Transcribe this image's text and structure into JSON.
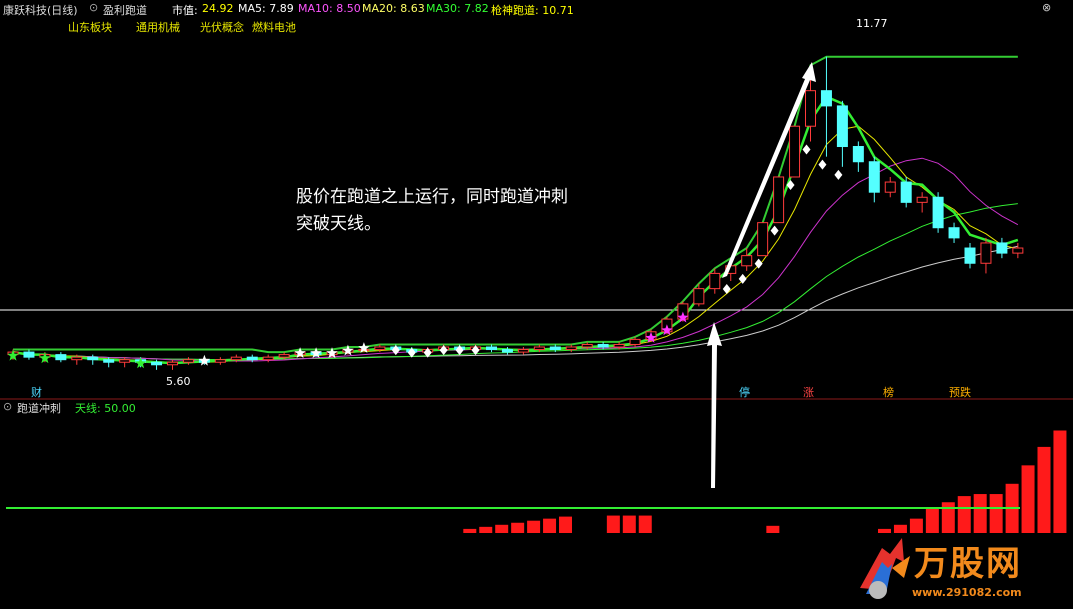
{
  "header": {
    "stock_name": "康跃科技(日线)",
    "indicator_name": "盈利跑道",
    "market_value_label": "市值:",
    "market_value": "24.92",
    "ma5": "MA5: 7.89",
    "ma10": "MA10: 8.50",
    "ma20": "MA20: 8.63",
    "ma30": "MA30: 7.82",
    "qsd": "枪神跑道: 10.71"
  },
  "tags": [
    "山东板块",
    "通用机械",
    "光伏概念",
    "燃料电池"
  ],
  "sub_indicator": {
    "name": "跑道冲刺",
    "tianxian": "天线: 50.00"
  },
  "annotation": {
    "line1": "股价在跑道之上运行，同时跑道冲刺",
    "line2": "突破天线。"
  },
  "price_labels": {
    "high": "11.77",
    "low": "5.60"
  },
  "event_markers": [
    {
      "text": "财",
      "color": "#4dd9ff"
    },
    {
      "text": "停",
      "color": "#4dd9ff"
    },
    {
      "text": "涨",
      "color": "#ff4444"
    },
    {
      "text": "榜",
      "color": "#ffb000"
    },
    {
      "text": "预跌",
      "color": "#ffb000"
    }
  ],
  "watermark": {
    "brand": "万股网",
    "url": "www.291082.com"
  },
  "colors": {
    "up": "#ff3b3b",
    "down": "#54ffff",
    "green_line": "#33ee33",
    "magenta_line": "#cc33cc",
    "yellow_line": "#e6e600",
    "white_line": "#cccccc",
    "track": "#33cc33",
    "header_yellow": "#ffff00",
    "ma10": "#ff55ff",
    "ma20": "#ffff66",
    "ma30": "#33ff33"
  },
  "chart_data": {
    "type": "candlestick",
    "candles": [
      [
        5.9,
        5.95,
        5.8,
        6.0
      ],
      [
        5.95,
        5.85,
        5.8,
        6.0
      ],
      [
        5.85,
        5.9,
        5.75,
        5.95
      ],
      [
        5.9,
        5.8,
        5.75,
        5.95
      ],
      [
        5.8,
        5.85,
        5.7,
        5.9
      ],
      [
        5.85,
        5.8,
        5.7,
        5.9
      ],
      [
        5.8,
        5.75,
        5.65,
        5.85
      ],
      [
        5.75,
        5.8,
        5.65,
        5.85
      ],
      [
        5.8,
        5.75,
        5.65,
        5.85
      ],
      [
        5.75,
        5.7,
        5.6,
        5.8
      ],
      [
        5.7,
        5.75,
        5.6,
        5.8
      ],
      [
        5.75,
        5.8,
        5.7,
        5.85
      ],
      [
        5.8,
        5.75,
        5.7,
        5.85
      ],
      [
        5.75,
        5.8,
        5.7,
        5.85
      ],
      [
        5.8,
        5.85,
        5.75,
        5.9
      ],
      [
        5.85,
        5.8,
        5.75,
        5.9
      ],
      [
        5.8,
        5.85,
        5.75,
        5.9
      ],
      [
        5.85,
        5.9,
        5.8,
        5.95
      ],
      [
        5.9,
        5.95,
        5.85,
        6.0
      ],
      [
        5.95,
        5.9,
        5.85,
        6.0
      ],
      [
        5.9,
        5.95,
        5.85,
        6.0
      ],
      [
        5.95,
        6.0,
        5.9,
        6.05
      ],
      [
        6.0,
        6.0,
        5.95,
        6.05
      ],
      [
        6.0,
        6.05,
        5.95,
        6.1
      ],
      [
        6.05,
        6.0,
        5.95,
        6.1
      ],
      [
        6.0,
        5.95,
        5.9,
        6.05
      ],
      [
        5.95,
        6.0,
        5.9,
        6.05
      ],
      [
        6.0,
        6.05,
        5.95,
        6.1
      ],
      [
        6.05,
        6.0,
        5.95,
        6.1
      ],
      [
        6.0,
        6.05,
        5.95,
        6.1
      ],
      [
        6.05,
        6.0,
        5.95,
        6.1
      ],
      [
        6.0,
        5.95,
        5.9,
        6.05
      ],
      [
        5.95,
        6.0,
        5.9,
        6.05
      ],
      [
        6.0,
        6.05,
        5.95,
        6.1
      ],
      [
        6.05,
        6.0,
        5.95,
        6.1
      ],
      [
        6.0,
        6.05,
        5.95,
        6.1
      ],
      [
        6.05,
        6.1,
        6.0,
        6.15
      ],
      [
        6.1,
        6.05,
        6.0,
        6.15
      ],
      [
        6.05,
        6.1,
        6.0,
        6.15
      ],
      [
        6.1,
        6.2,
        6.05,
        6.25
      ],
      [
        6.2,
        6.35,
        6.15,
        6.4
      ],
      [
        6.35,
        6.6,
        6.3,
        6.65
      ],
      [
        6.6,
        6.9,
        6.55,
        6.95
      ],
      [
        6.9,
        7.2,
        6.85,
        7.3
      ],
      [
        7.2,
        7.5,
        7.1,
        7.6
      ],
      [
        7.5,
        7.65,
        7.35,
        7.8
      ],
      [
        7.65,
        7.85,
        7.55,
        8.0
      ],
      [
        7.85,
        8.5,
        7.85,
        8.5
      ],
      [
        8.5,
        9.4,
        8.5,
        9.4
      ],
      [
        9.4,
        10.4,
        9.4,
        10.4
      ],
      [
        10.4,
        11.1,
        10.1,
        11.6
      ],
      [
        11.1,
        10.8,
        9.8,
        11.77
      ],
      [
        10.8,
        10.0,
        9.6,
        10.9
      ],
      [
        10.0,
        9.7,
        9.5,
        10.1
      ],
      [
        9.7,
        9.1,
        8.9,
        9.8
      ],
      [
        9.1,
        9.3,
        9.0,
        9.4
      ],
      [
        9.3,
        8.9,
        8.8,
        9.4
      ],
      [
        8.9,
        9.0,
        8.7,
        9.1
      ],
      [
        9.0,
        8.4,
        8.3,
        9.1
      ],
      [
        8.4,
        8.2,
        8.1,
        8.5
      ],
      [
        8.0,
        7.7,
        7.6,
        8.1
      ],
      [
        7.7,
        8.1,
        7.5,
        8.2
      ],
      [
        8.1,
        7.9,
        7.8,
        8.2
      ],
      [
        7.9,
        8.0,
        7.8,
        8.1
      ]
    ],
    "price_range": [
      5.4,
      12.0
    ],
    "track_line_start_index": 0,
    "tianxian": 50,
    "bars": [
      0,
      0,
      0,
      0,
      0,
      0,
      0,
      0,
      0,
      0,
      0,
      0,
      0,
      0,
      4,
      6,
      8,
      10,
      12,
      14,
      16,
      0,
      0,
      17,
      17,
      17,
      0,
      0,
      0,
      0,
      0,
      0,
      0,
      7,
      0,
      0,
      0,
      0,
      0,
      0,
      4,
      8,
      14,
      24,
      30,
      36,
      38,
      38,
      48,
      66,
      84,
      100,
      108,
      110,
      0,
      0,
      0,
      0,
      0,
      0,
      0,
      0,
      0,
      0
    ],
    "bar_range": [
      0,
      120
    ]
  }
}
